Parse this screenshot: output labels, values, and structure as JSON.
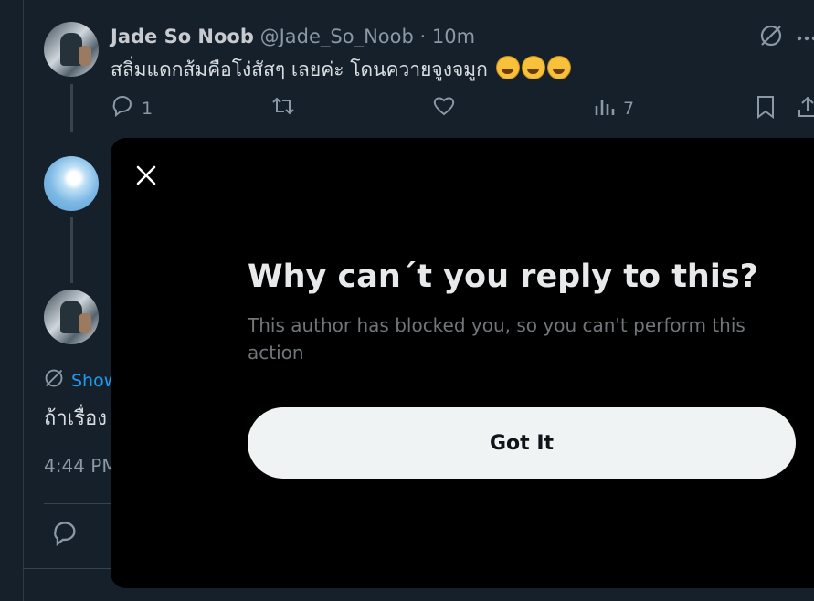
{
  "tweet": {
    "author_name": "Jade So Noob",
    "author_handle": "@Jade_So_Noob",
    "time_sep": "·",
    "time": "10m",
    "text": "สลิ่มแดกส้มคือโง่สัสๆ เลยค่ะ โดนควายจูงจมูก",
    "emoji_count": 3,
    "emoji_icon": "rolling-on-floor-laughing-emoji",
    "reply_count": "1",
    "view_count": "7",
    "icons": {
      "muted": "muted-icon",
      "more": "more-dots-icon",
      "reply": "reply-icon",
      "retweet": "retweet-icon",
      "like": "heart-icon",
      "views": "views-chart-icon",
      "bookmark": "bookmark-icon",
      "share": "share-icon"
    }
  },
  "reply_thread": {
    "show_more_label": "Show",
    "text": "ถ้าเรื่อง",
    "timestamp": "4:44 PM"
  },
  "modal": {
    "title": "Why can´t you reply to this?",
    "description": "This author has blocked you, so you can't perform this action",
    "button_label": "Got It",
    "close_icon": "close-icon"
  },
  "colors": {
    "background": "#15202b",
    "modal_bg": "#000000",
    "button_bg": "#eff3f4",
    "link_blue": "#1d9bf0",
    "muted_text": "#71767b"
  }
}
